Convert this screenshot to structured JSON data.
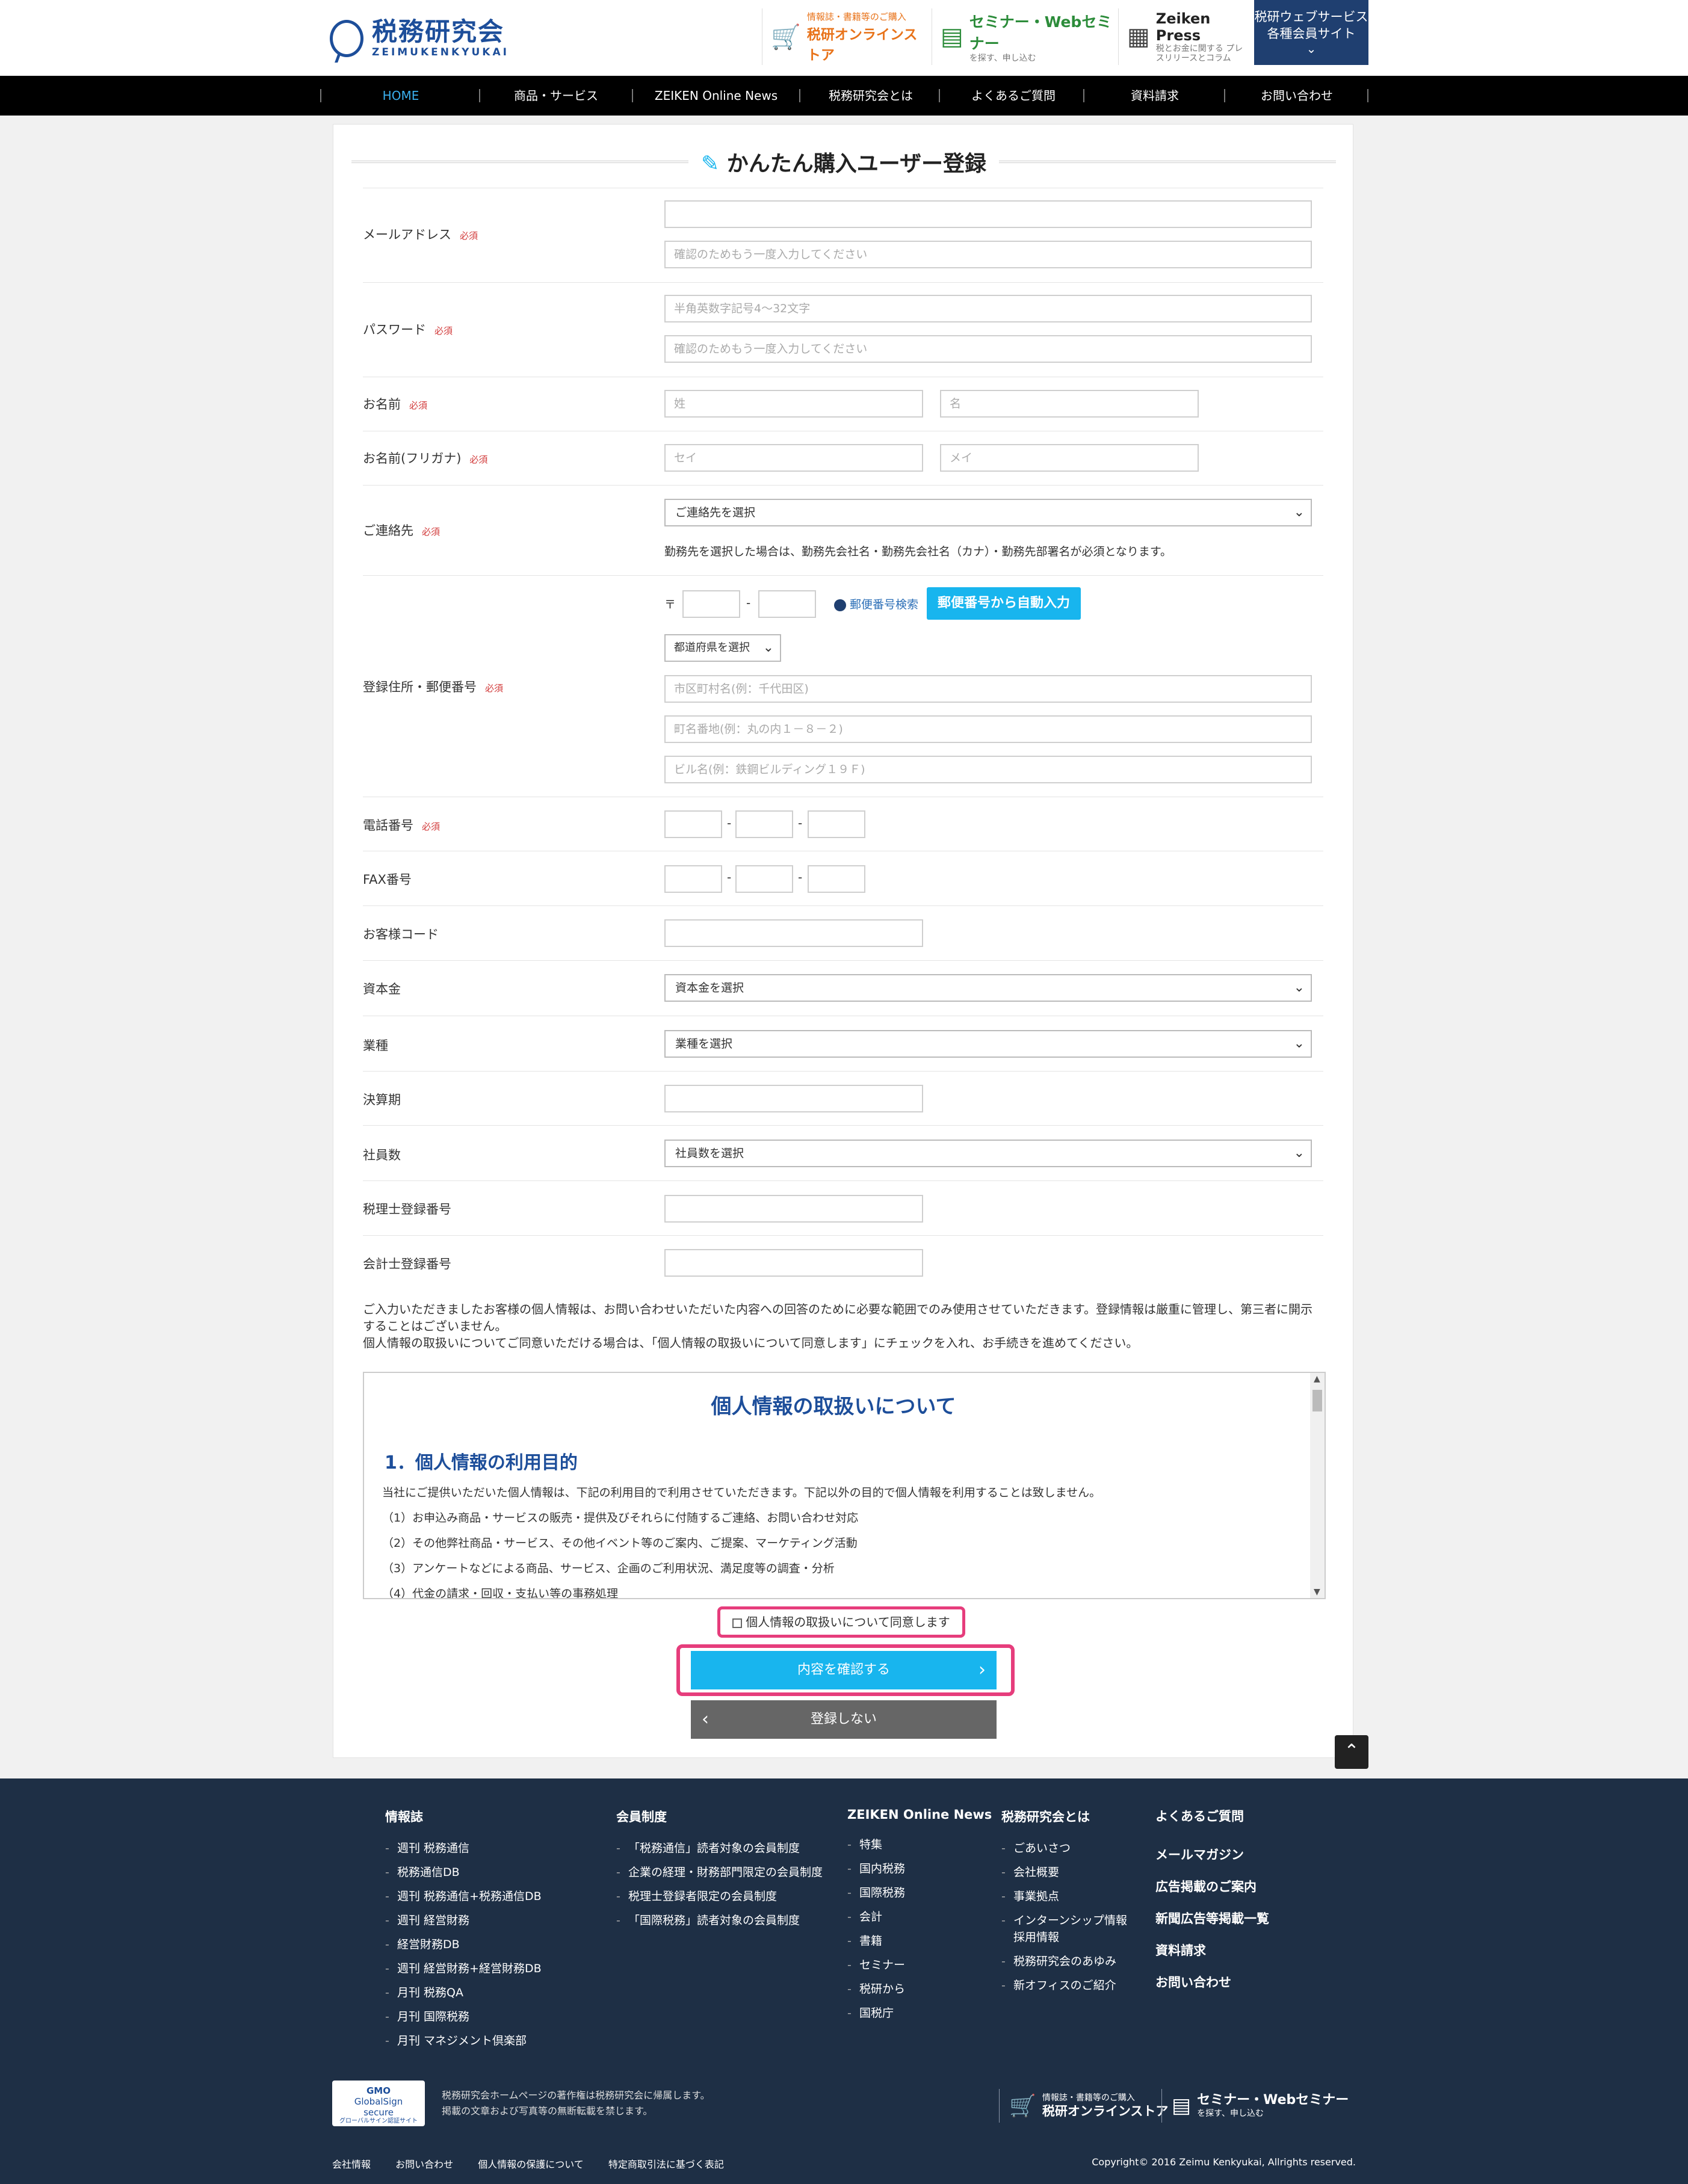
{
  "header": {
    "logo_ja": "税務研究会",
    "logo_en": "ZEIMUKENKYUKAI",
    "store_small": "情報誌・書籍等のご購入",
    "store_label": "税研オンラインストア",
    "seminar_label": "セミナー・Webセミナー",
    "seminar_small": "を探す、申し込む",
    "press_label": "Zeiken Press",
    "press_small": "税とお金に関する プレスリリースとコラム",
    "member_line1": "税研ウェブサービス",
    "member_line2": "各種会員サイト"
  },
  "nav": [
    {
      "label": "HOME"
    },
    {
      "label": "商品・サービス"
    },
    {
      "label": "ZEIKEN Online News"
    },
    {
      "label": "税務研究会とは"
    },
    {
      "label": "よくあるご質問"
    },
    {
      "label": "資料請求"
    },
    {
      "label": "お問い合わせ"
    }
  ],
  "form": {
    "title": "かんたん購入ユーザー登録",
    "required": "必須",
    "email_label": "メールアドレス",
    "email_confirm_ph": "確認のためもう一度入力してください",
    "password_label": "パスワード",
    "password_ph": "半角英数字記号4～32文字",
    "password_confirm_ph": "確認のためもう一度入力してください",
    "name_label": "お名前",
    "last_ph": "姓",
    "first_ph": "名",
    "kana_label": "お名前(フリガナ)",
    "kana_last_ph": "セイ",
    "kana_first_ph": "メイ",
    "contact_label": "ご連絡先",
    "contact_select": "ご連絡先を選択",
    "contact_note": "勤務先を選択した場合は、勤務先会社名・勤務先会社名（カナ）・勤務先部署名が必須となります。",
    "address_label": "登録住所・郵便番号",
    "zip_mark": "〒",
    "zip_search": "郵便番号検索",
    "zip_auto_button": "郵便番号から自動入力",
    "pref_select": "都道府県を選択",
    "city_ph": "市区町村名(例：千代田区)",
    "town_ph": "町名番地(例：丸の内１－８－２)",
    "building_ph": "ビル名(例：鉄鋼ビルディング１９Ｆ)",
    "tel_label": "電話番号",
    "fax_label": "FAX番号",
    "customer_code_label": "お客様コード",
    "capital_label": "資本金",
    "capital_select": "資本金を選択",
    "industry_label": "業種",
    "industry_select": "業種を選択",
    "fiscal_label": "決算期",
    "employees_label": "社員数",
    "employees_select": "社員数を選択",
    "tax_accountant_label": "税理士登録番号",
    "cpa_label": "会計士登録番号",
    "dash": "-"
  },
  "privacy": {
    "intro1": "ご入力いただきましたお客様の個人情報は、お問い合わせいただいた内容への回答のために必要な範囲でのみ使用させていただきます。登録情報は厳重に管理し、第三者に開示することはございません。",
    "intro2": "個人情報の取扱いについてご同意いただける場合は、「個人情報の取扱いについて同意します」にチェックを入れ、お手続きを進めてください。",
    "box_title": "個人情報の取扱いについて",
    "section_title": "1．個人情報の利用目的",
    "p0": "当社にご提供いただいた個人情報は、下記の利用目的で利用させていただきます。下記以外の目的で個人情報を利用することは致しません。",
    "p1": "（1）お申込み商品・サービスの販売・提供及びそれらに付随するご連絡、お問い合わせ対応",
    "p2": "（2）その他弊社商品・サービス、その他イベント等のご案内、ご提案、マーケティング活動",
    "p3": "（3）アンケートなどによる商品、サービス、企画のご利用状況、満足度等の調査・分析",
    "p4": "（4）代金の請求・回収・支払い等の事務処理",
    "agree_label": "個人情報の取扱いについて同意します",
    "confirm_button": "内容を確認する",
    "cancel_button": "登録しない"
  },
  "footer": {
    "col1_title": "情報誌",
    "col1": [
      "週刊 税務通信",
      "税務通信DB",
      "週刊 税務通信+税務通信DB",
      "週刊 経営財務",
      "経営財務DB",
      "週刊 経営財務+経営財務DB",
      "月刊 税務QA",
      "月刊 国際税務",
      "月刊 マネジメント倶楽部"
    ],
    "col2_title": "会員制度",
    "col2": [
      "「税務通信」読者対象の会員制度",
      "企業の経理・財務部門限定の会員制度",
      "税理士登録者限定の会員制度",
      "「国際税務」読者対象の会員制度"
    ],
    "col3_title": "ZEIKEN Online News",
    "col3": [
      "特集",
      "国内税務",
      "国際税務",
      "会計",
      "書籍",
      "セミナー",
      "税研から",
      "国税庁"
    ],
    "col4_title": "税務研究会とは",
    "col4": [
      "ごあいさつ",
      "会社概要",
      "事業拠点",
      "インターンシップ情報",
      "税務研究会のあゆみ",
      "新オフィスのご紹介"
    ],
    "col4_extra": "採用情報",
    "col5": [
      "よくあるご質問",
      "メールマガジン",
      "広告掲載のご案内",
      "新聞広告等掲載一覧",
      "資料請求",
      "お問い合わせ"
    ],
    "gsign_line1": "GMO",
    "gsign_line2": "GlobalSign",
    "gsign_line3": "secure",
    "gsign_line4": "グローバルサイン認証サイト",
    "note1": "税務研究会ホームページの著作権は税務研究会に帰属します。",
    "note2": "掲載の文章および写真等の無断転載を禁じます。",
    "store_small": "情報誌・書籍等のご購入",
    "store_label": "税研オンラインストア",
    "seminar_label": "セミナー・Webセミナー",
    "seminar_small": "を探す、申し込む",
    "bottom_links": [
      "会社情報",
      "お問い合わせ",
      "個人情報の保護について",
      "特定商取引法に基づく表記"
    ],
    "copyright": "Copyright© 2016 Zeimu Kenkyukai, Allrights reserved."
  }
}
